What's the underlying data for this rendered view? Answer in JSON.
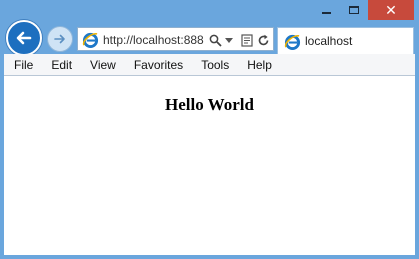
{
  "window": {
    "controls": {
      "minimize": "minimize",
      "maximize": "maximize",
      "close": "close"
    }
  },
  "nav": {
    "back_icon": "back-arrow-icon",
    "forward_icon": "forward-arrow-icon"
  },
  "address": {
    "url": "http://localhost:888",
    "icons": [
      "ie-logo-icon",
      "search-icon",
      "dropdown-icon",
      "compat-view-icon",
      "refresh-icon"
    ]
  },
  "tab": {
    "title": "localhost",
    "icon": "ie-logo-icon"
  },
  "menu": {
    "items": [
      "File",
      "Edit",
      "View",
      "Favorites",
      "Tools",
      "Help"
    ]
  },
  "page": {
    "heading": "Hello World"
  },
  "colors": {
    "frame": "#6aa6dd",
    "close": "#c74a3c",
    "back_button": "#1d6fbf"
  }
}
